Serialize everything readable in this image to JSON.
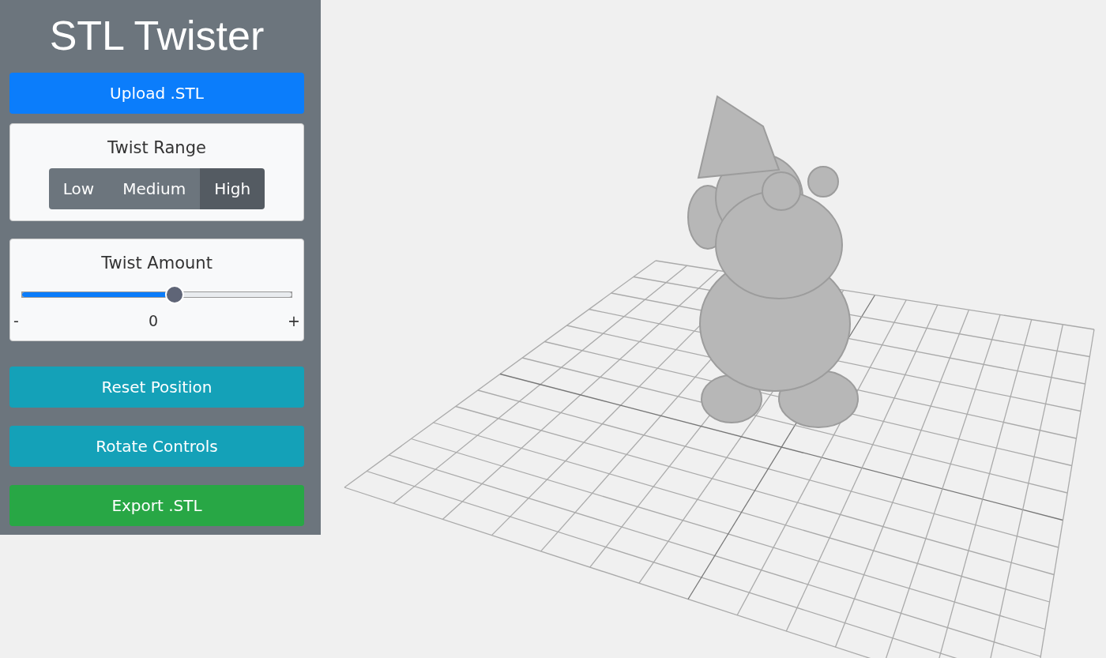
{
  "app_title": "STL Twister",
  "upload_button": "Upload .STL",
  "twist_range": {
    "title": "Twist Range",
    "options": [
      {
        "label": "Low",
        "selected": false
      },
      {
        "label": "Medium",
        "selected": false
      },
      {
        "label": "High",
        "selected": true
      }
    ]
  },
  "twist_amount": {
    "title": "Twist Amount",
    "level": 0.57,
    "min_label": "-",
    "value": "0",
    "max_label": "+"
  },
  "buttons": [
    {
      "label": "Reset Position",
      "kind": "secondary"
    },
    {
      "label": "Rotate Controls",
      "kind": "secondary"
    },
    {
      "label": "Export .STL",
      "kind": "export"
    }
  ]
}
